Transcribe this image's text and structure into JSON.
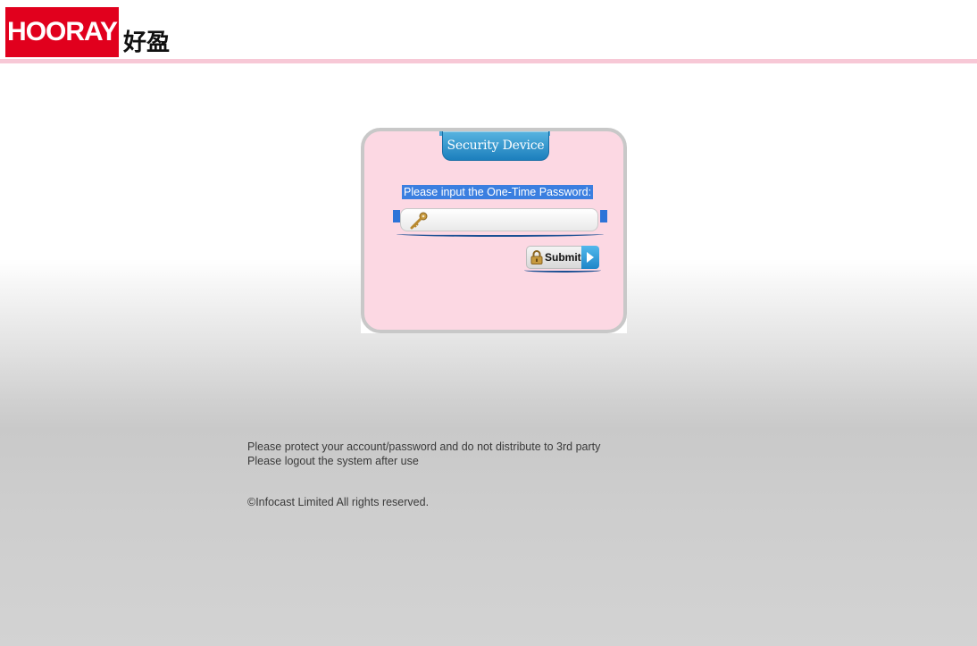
{
  "header": {
    "logo_text": "HOORAY",
    "logo_cn": "好盈",
    "brand_color": "#e1001d",
    "rule_color": "#f7c8d6"
  },
  "panel": {
    "tab_title": "Security Device",
    "prompt": "Please input the One-Time Password:",
    "otp_value": "",
    "otp_icon": "key-icon",
    "submit_label": "Submit",
    "submit_icons": [
      "lock-icon",
      "play-arrow-icon"
    ],
    "panel_color": "#fcd8e3",
    "tab_color": "#1c7fbd"
  },
  "footer": {
    "notice_1": "Please protect your account/password and do not distribute to 3rd party",
    "notice_2": "Please logout the system after use",
    "copyright": "©Infocast Limited All rights reserved."
  }
}
